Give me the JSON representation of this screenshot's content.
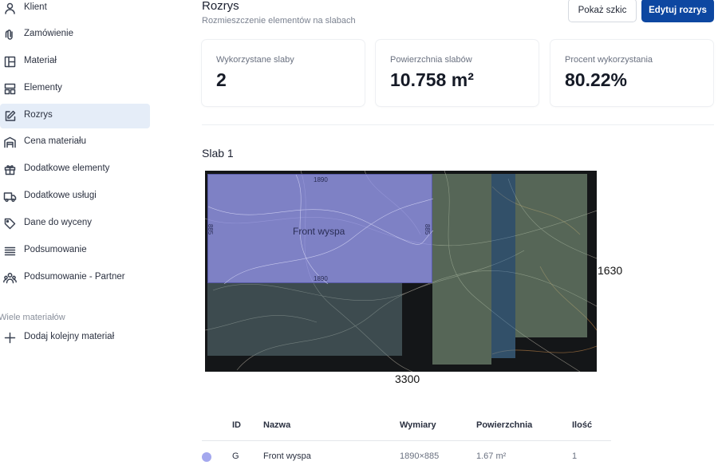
{
  "sidebar": {
    "items": [
      {
        "label": "Klient",
        "icon": "user-icon",
        "active": false
      },
      {
        "label": "Zamówienie",
        "icon": "paperclip-icon",
        "active": false
      },
      {
        "label": "Materiał",
        "icon": "layout-icon",
        "active": false
      },
      {
        "label": "Elementy",
        "icon": "elements-icon",
        "active": false
      },
      {
        "label": "Rozrys",
        "icon": "edit-icon",
        "active": true
      },
      {
        "label": "Cena materiału",
        "icon": "warehouse-icon",
        "active": false
      },
      {
        "label": "Dodatkowe elementy",
        "icon": "gift-icon",
        "active": false
      },
      {
        "label": "Dodatkowe usługi",
        "icon": "truck-icon",
        "active": false
      },
      {
        "label": "Dane do wyceny",
        "icon": "tag-icon",
        "active": false
      },
      {
        "label": "Podsumowanie",
        "icon": "list-icon",
        "active": false
      },
      {
        "label": "Podsumowanie - Partner",
        "icon": "users-icon",
        "active": false
      }
    ],
    "section_label": "Wiele materiałów",
    "add_material_label": "Dodaj kolejny materiał"
  },
  "header": {
    "title": "Rozrys",
    "subtitle": "Rozmieszczenie elementów na slabach",
    "show_sketch_label": "Pokaż szkic",
    "edit_layout_label": "Edytuj rozrys"
  },
  "stats": [
    {
      "label": "Wykorzystane slaby",
      "value": "2"
    },
    {
      "label": "Powierzchnia slabów",
      "value": "10.758 m²"
    },
    {
      "label": "Procent wykorzystania",
      "value": "80.22%"
    }
  ],
  "slab": {
    "title": "Slab 1",
    "width_label": "3300",
    "height_label": "1630",
    "main_piece": {
      "name": "Front wyspa",
      "top_dim": "1890",
      "bottom_dim": "1890",
      "left_dim": "885",
      "right_dim": "885"
    }
  },
  "table": {
    "headers": {
      "id": "ID",
      "name": "Nazwa",
      "dims": "Wymiary",
      "area": "Powierzchnia",
      "qty": "Ilość"
    },
    "rows": [
      {
        "id": "G",
        "name": "Front wyspa",
        "dims": "1890×885",
        "area": "1.67 m²",
        "qty": "1",
        "color": "#a4a8ee"
      }
    ]
  },
  "colors": {
    "accent": "#0d47a1",
    "active_bg": "#e5edf8",
    "main_piece": "#9698ec"
  }
}
